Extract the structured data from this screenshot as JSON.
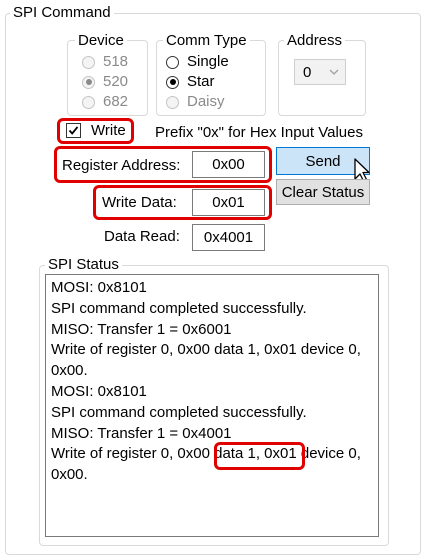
{
  "spi_command": {
    "title": "SPI Command",
    "device": {
      "title": "Device",
      "options": [
        {
          "label": "518",
          "selected": false,
          "enabled": false
        },
        {
          "label": "520",
          "selected": true,
          "enabled": false
        },
        {
          "label": "682",
          "selected": false,
          "enabled": false
        }
      ]
    },
    "comm_type": {
      "title": "Comm Type",
      "options": [
        {
          "label": "Single",
          "selected": false,
          "enabled": true
        },
        {
          "label": "Star",
          "selected": true,
          "enabled": true
        },
        {
          "label": "Daisy",
          "selected": false,
          "enabled": false
        }
      ]
    },
    "address": {
      "title": "Address",
      "value": "0"
    },
    "write_checkbox": {
      "label": "Write",
      "checked": true
    },
    "hint": "Prefix \"0x\" for Hex Input Values",
    "register_address": {
      "label": "Register Address:",
      "value": "0x00"
    },
    "write_data": {
      "label": "Write Data:",
      "value": "0x01"
    },
    "data_read": {
      "label": "Data Read:",
      "value": "0x4001"
    },
    "buttons": {
      "send": "Send",
      "clear_status": "Clear Status"
    },
    "spi_status": {
      "title": "SPI Status",
      "lines": [
        "MOSI: 0x8101",
        "SPI command completed successfully.",
        "MISO: Transfer 1 = 0x6001",
        "Write of register 0, 0x00 data 1, 0x01 device 0,",
        "0x00.",
        "MOSI: 0x8101",
        "SPI command completed successfully.",
        "MISO: Transfer 1 = 0x4001",
        "Write of register 0, 0x00 data 1, 0x01 device 0,",
        "0x00."
      ]
    },
    "highlight_color": "#e00000",
    "accent_color": "#cce4f7"
  }
}
